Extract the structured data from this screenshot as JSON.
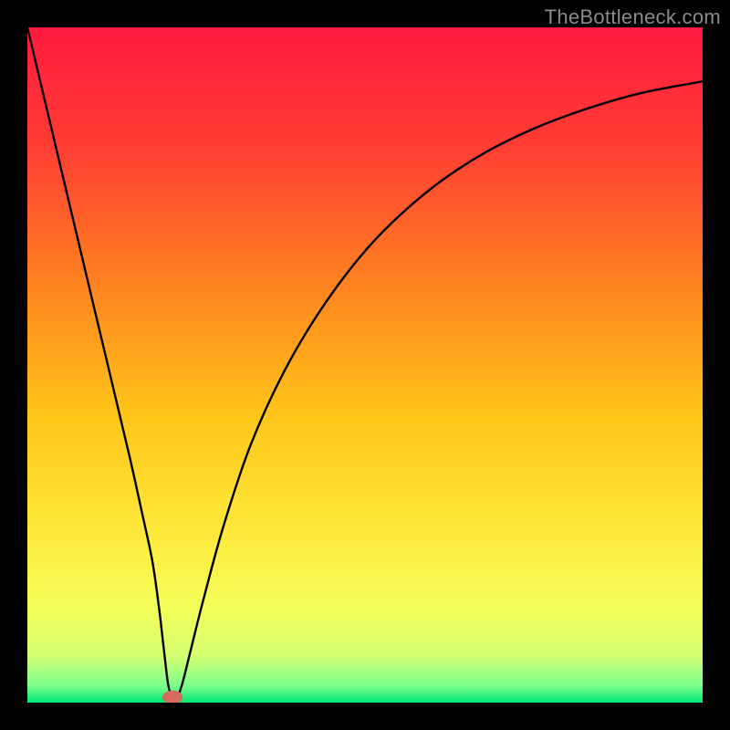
{
  "watermark": "TheBottleneck.com",
  "chart_data": {
    "type": "line",
    "title": "",
    "xlabel": "",
    "ylabel": "",
    "xlim": [
      0,
      100
    ],
    "ylim": [
      0,
      100
    ],
    "axes_visible": false,
    "grid": false,
    "gradient_stops": [
      {
        "offset": 0.0,
        "color": "#ff1a3f"
      },
      {
        "offset": 0.18,
        "color": "#ff3e33"
      },
      {
        "offset": 0.4,
        "color": "#ff8a1f"
      },
      {
        "offset": 0.58,
        "color": "#ffc61a"
      },
      {
        "offset": 0.75,
        "color": "#ffe93d"
      },
      {
        "offset": 0.86,
        "color": "#f4ff5a"
      },
      {
        "offset": 0.93,
        "color": "#d6ff70"
      },
      {
        "offset": 0.975,
        "color": "#7dff8c"
      },
      {
        "offset": 1.0,
        "color": "#00e676"
      }
    ],
    "series": [
      {
        "name": "bottleneck-curve",
        "x": [
          0,
          5,
          10,
          15,
          17,
          18.5,
          19.5,
          20.2,
          20.8,
          21.3,
          21.8,
          22.3,
          23,
          24,
          26,
          29,
          33,
          38,
          44,
          51,
          59,
          67,
          75,
          83,
          91,
          100
        ],
        "y": [
          100,
          79,
          58,
          37,
          28,
          21,
          14,
          8,
          3,
          1,
          0.5,
          1,
          3,
          7,
          15,
          26,
          38,
          49,
          59,
          68,
          75.5,
          81,
          85,
          88,
          90.3,
          92
        ]
      }
    ],
    "marker": {
      "name": "min-point",
      "x": 21.5,
      "y": 0.8,
      "rx": 1.5,
      "ry": 1.0,
      "color": "#d46a5a"
    }
  }
}
